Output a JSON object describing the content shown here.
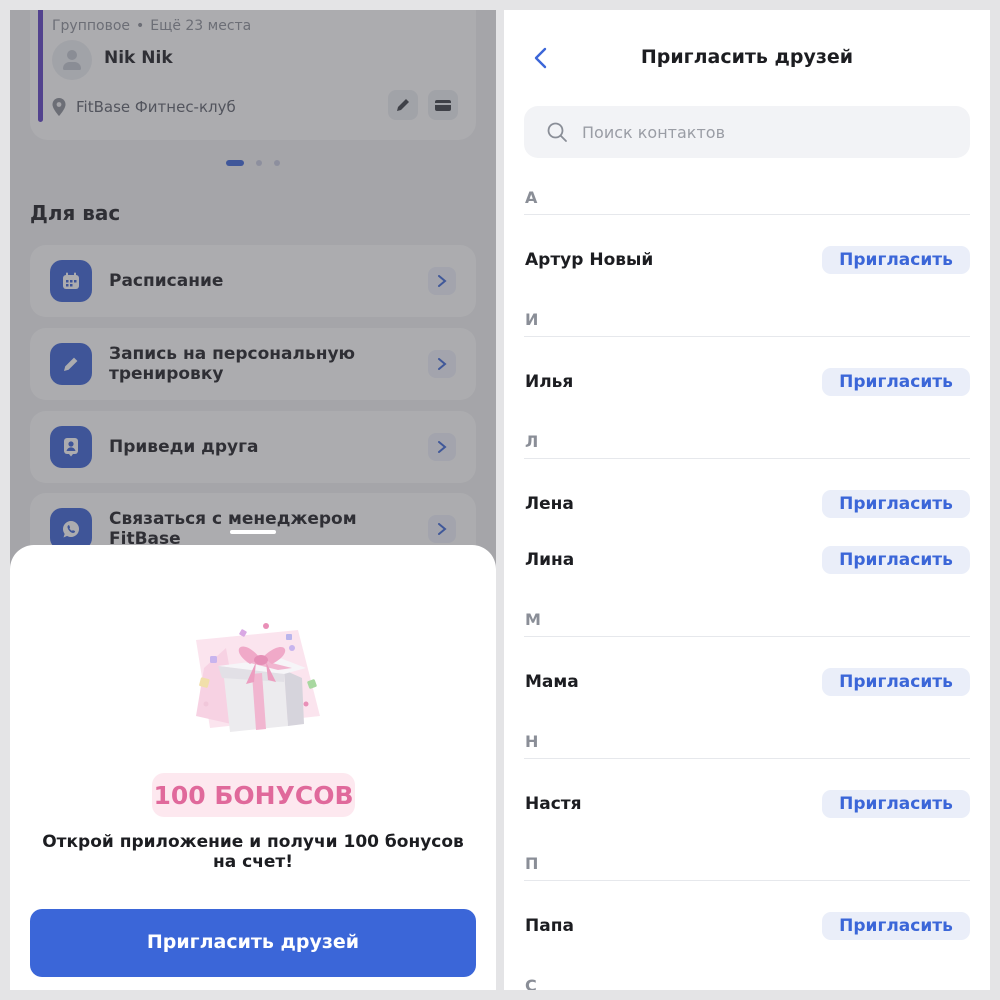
{
  "background_app": {
    "class_card": {
      "type": "Групповое",
      "separator": "•",
      "spots": "Ещё 23 места",
      "trainer": "Nik Nik",
      "club": "FitBase Фитнес-клуб"
    },
    "section_title": "Для вас",
    "menu": [
      {
        "label": "Расписание",
        "icon": "calendar-icon"
      },
      {
        "label": "Запись на персональную тренировку",
        "icon": "pencil-icon"
      },
      {
        "label": "Приведи друга",
        "icon": "person-badge-icon"
      },
      {
        "label": "Связаться с менеджером FitBase",
        "icon": "whatsapp-icon"
      }
    ]
  },
  "sheet": {
    "bonus": "100 БОНУСОВ",
    "description": "Открой приложение и получи 100 бонусов на счет!",
    "cta": "Пригласить друзей"
  },
  "invite_screen": {
    "title": "Пригласить друзей",
    "search_placeholder": "Поиск контактов",
    "invite_label": "Пригласить",
    "groups": [
      {
        "letter": "А",
        "contacts": [
          "Артур Новый"
        ]
      },
      {
        "letter": "И",
        "contacts": [
          "Илья"
        ]
      },
      {
        "letter": "Л",
        "contacts": [
          "Лена",
          "Лина"
        ]
      },
      {
        "letter": "М",
        "contacts": [
          "Мама"
        ]
      },
      {
        "letter": "Н",
        "contacts": [
          "Настя"
        ]
      },
      {
        "letter": "П",
        "contacts": [
          "Папа"
        ]
      },
      {
        "letter": "С",
        "contacts": []
      }
    ]
  },
  "colors": {
    "accent": "#3b66d8",
    "invite_bg": "#eaeef9",
    "bonus_text": "#e0699b",
    "bonus_bg": "#fde8ef",
    "class_accent": "#5b3fc4"
  }
}
